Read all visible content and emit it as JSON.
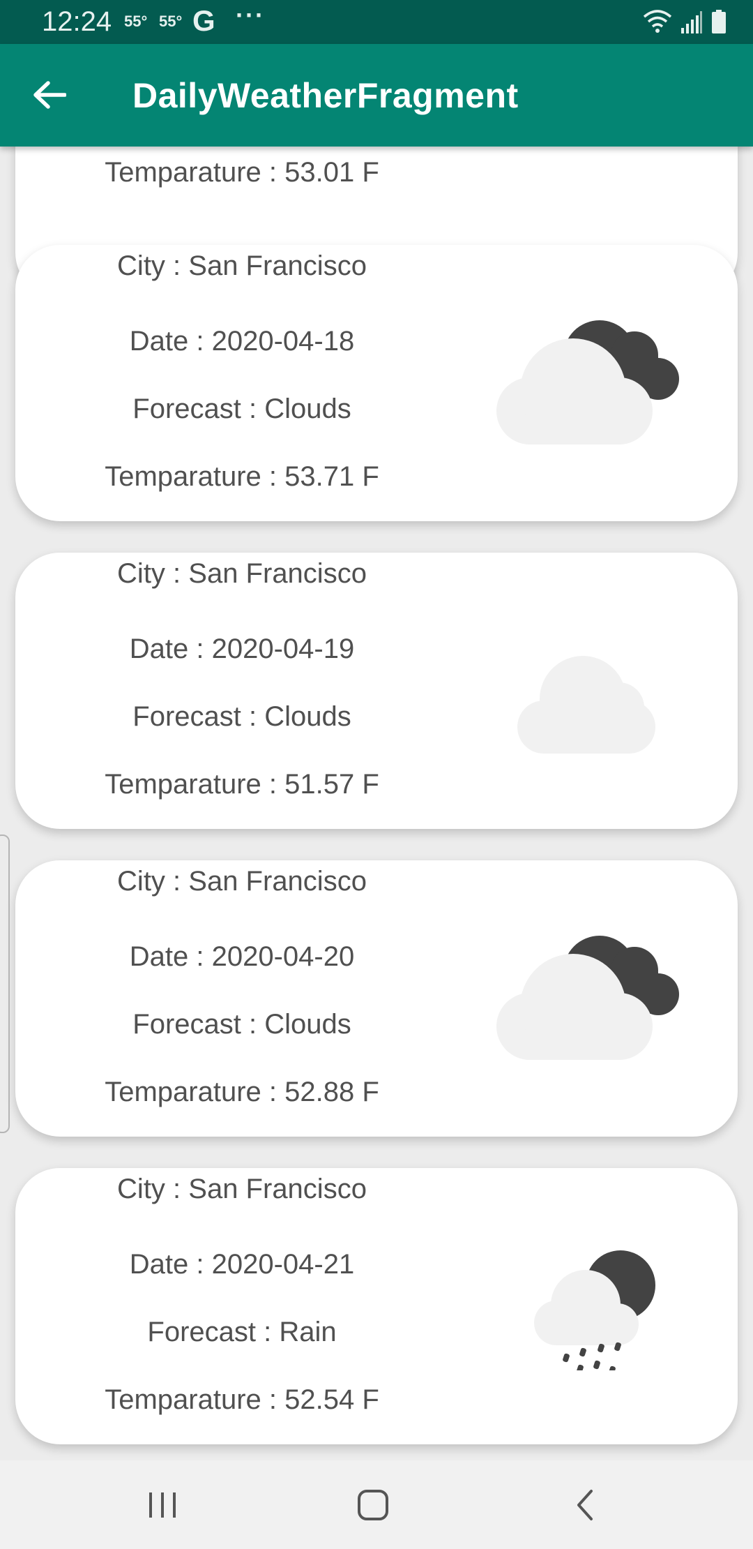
{
  "status_bar": {
    "time": "12:24",
    "temp_1": "55°",
    "temp_2": "55°",
    "google_glyph": "G",
    "more_dots": "···",
    "icons": [
      "wifi-icon",
      "signal-icon",
      "battery-icon"
    ]
  },
  "app_bar": {
    "title": "DailyWeatherFragment",
    "back_icon": "arrow-left-icon",
    "background_color": "#048573"
  },
  "cards": [
    {
      "temperature": "Temparature : 53.01 F"
    },
    {
      "city": "City : San Francisco",
      "date": "Date : 2020-04-18",
      "forecast": "Forecast : Clouds",
      "temperature": "Temparature : 53.71 F",
      "icon": "cloudy-night-icon"
    },
    {
      "city": "City : San Francisco",
      "date": "Date : 2020-04-19",
      "forecast": "Forecast : Clouds",
      "temperature": "Temparature : 51.57 F",
      "icon": "cloud-icon"
    },
    {
      "city": "City : San Francisco",
      "date": "Date : 2020-04-20",
      "forecast": "Forecast : Clouds",
      "temperature": "Temparature : 52.88 F",
      "icon": "cloudy-night-icon"
    },
    {
      "city": "City : San Francisco",
      "date": "Date : 2020-04-21",
      "forecast": "Forecast : Rain",
      "temperature": "Temparature : 52.54 F",
      "icon": "rain-night-icon"
    }
  ],
  "nav_bar": {
    "buttons": [
      "recent-apps-icon",
      "home-icon",
      "back-icon"
    ]
  }
}
